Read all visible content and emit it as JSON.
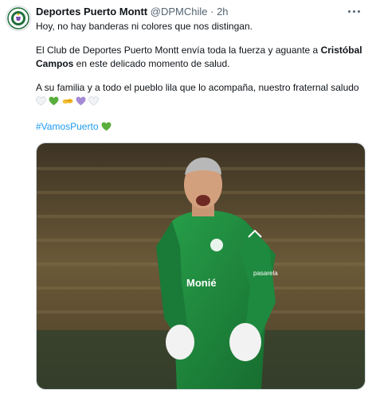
{
  "tweet": {
    "author_name": "Deportes Puerto Montt",
    "author_handle": "@DPMChile",
    "separator": "·",
    "timestamp": "2h",
    "line1": "Hoy, no hay banderas ni colores que nos distingan.",
    "para2_part1": "El Club de Deportes Puerto Montt envía toda la fuerza y aguante a ",
    "para2_bold": "Cristóbal Campos",
    "para2_part2": " en este delicado momento de salud.",
    "para3": "A su familia y a todo el pueblo lila que lo acompaña, nuestro fraternal saludo",
    "para3_emojis": [
      "white-heart",
      "green-heart",
      "handshake",
      "purple-heart",
      "white-heart"
    ],
    "hashtag": "#VamosPuerto",
    "hashtag_emoji": "green-heart"
  },
  "media": {
    "description_icon": "goalkeeper-photo",
    "jersey_sponsor": "Monié",
    "jersey_brand": "pasarela",
    "colors": {
      "jersey": "#1f8a3c",
      "background": "#5a4a2e"
    }
  },
  "colors": {
    "text": "#0f1419",
    "secondary": "#536471",
    "link": "#1d9bf0",
    "border": "#cfd9de"
  }
}
